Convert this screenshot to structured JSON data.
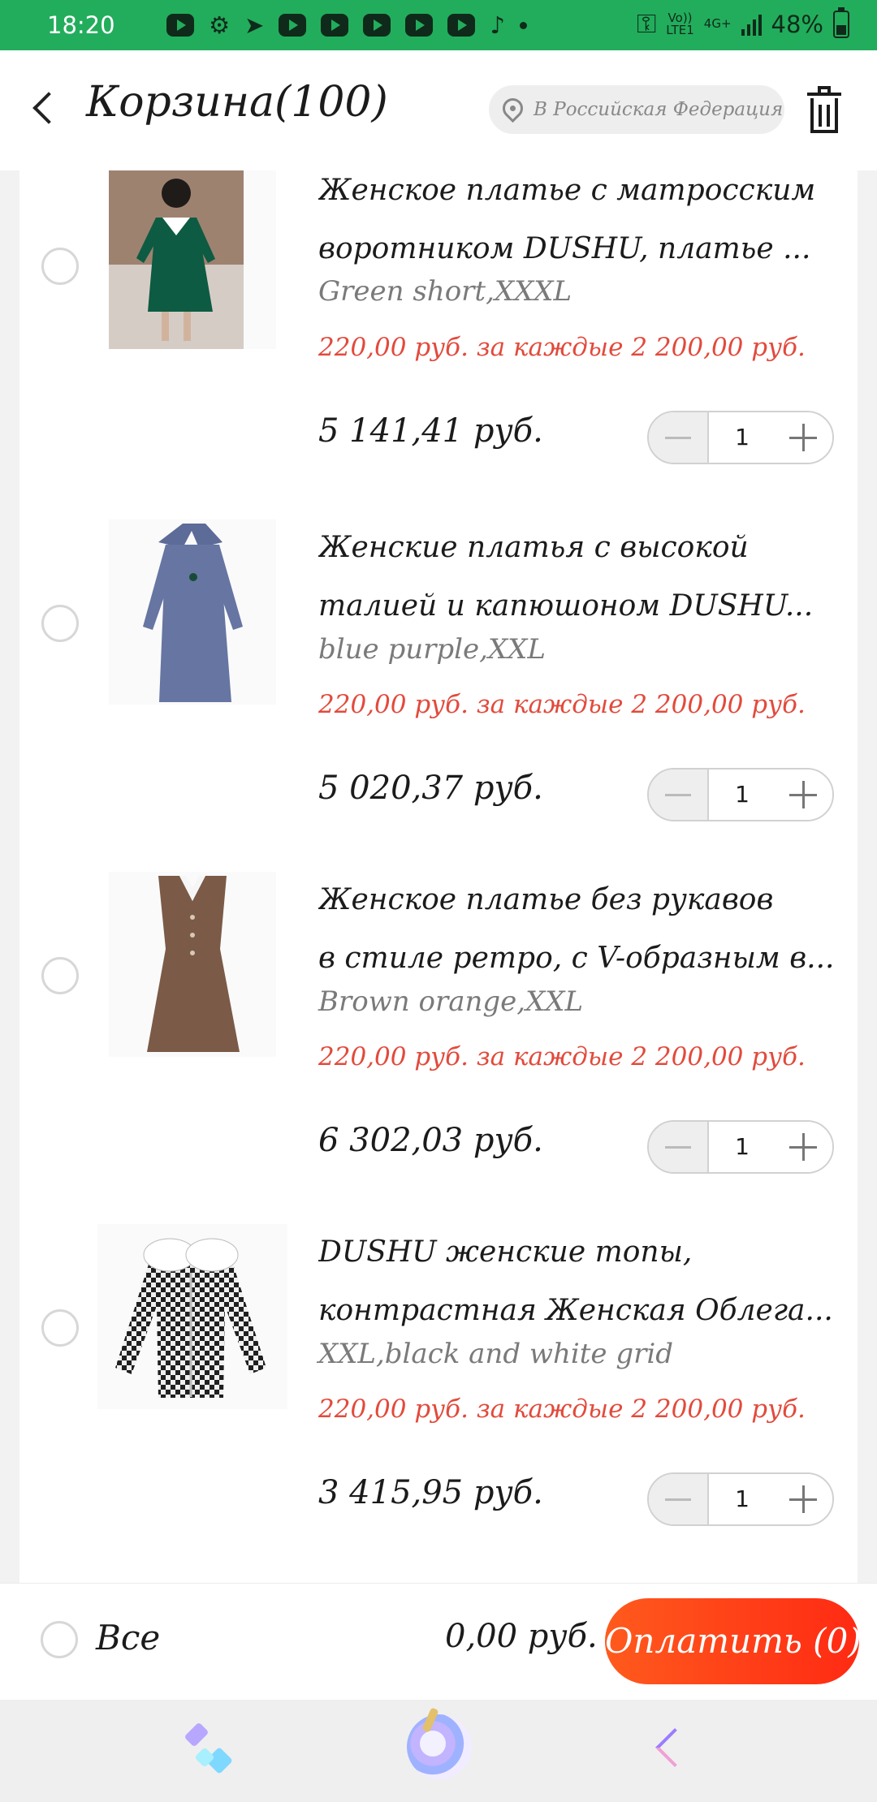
{
  "status_bar": {
    "time": "18:20",
    "network_top": "Vo))",
    "network_mid": "LTE1",
    "network_speed": "4G+",
    "battery_percent": "48%",
    "battery_level": 0.48
  },
  "header": {
    "title": "Корзина(100)",
    "region": "В Российская Федерация"
  },
  "items": [
    {
      "title": "Женское платье с матросским воротником DUSHU, платье ...",
      "title_line1": "Женское платье с матросским",
      "title_line2": "воротником DUSHU, платье ...",
      "variant": "Green short,XXXL",
      "promo": "220,00 руб. за каждые 2 200,00 руб.",
      "price": "5 141,41 руб.",
      "quantity": "1",
      "image_colors": {
        "bg": "#b79a86",
        "garment": "#0d5b42"
      }
    },
    {
      "title": "Женские платья с высокой талией и капюшоном DUSHU...",
      "title_line1": "Женские платья с высокой",
      "title_line2": "талией и капюшоном DUSHU...",
      "variant": "blue purple,XXL",
      "promo": "220,00 руб. за каждые 2 200,00 руб.",
      "price": "5 020,37 руб.",
      "quantity": "1",
      "image_colors": {
        "bg": "#fafafa",
        "garment": "#6675a2"
      }
    },
    {
      "title": "Женское платье без рукавов в стиле ретро, с V-образным в...",
      "title_line1": "Женское платье без рукавов",
      "title_line2": "в стиле ретро, с V-образным в...",
      "variant": "Brown orange,XXL",
      "promo": "220,00 руб. за каждые 2 200,00 руб.",
      "price": "6 302,03 руб.",
      "quantity": "1",
      "image_colors": {
        "bg": "#fafafa",
        "garment": "#7b5a48"
      }
    },
    {
      "title": "DUSHU женские топы, контрастная Женская Облега...",
      "title_line1": "DUSHU женские топы,",
      "title_line2": "контрастная Женская Облега...",
      "variant": "XXL,black and white grid",
      "promo": "220,00 руб. за каждые 2 200,00 руб.",
      "price": "3 415,95 руб.",
      "quantity": "1",
      "image_colors": {
        "bg": "#fafafa",
        "garment": "#333333"
      }
    }
  ],
  "footer": {
    "select_all_label": "Все",
    "total": "0,00 руб.",
    "pay_label": "Оплатить (0)"
  },
  "navigation": {
    "left_icon": "crystals-icon",
    "center_icon": "unicorn-icon",
    "right_icon": "back-icon"
  },
  "colors": {
    "status_green": "#22ad5c",
    "promo_red": "#e24a3c",
    "pay_orange": "#ff3d17"
  }
}
